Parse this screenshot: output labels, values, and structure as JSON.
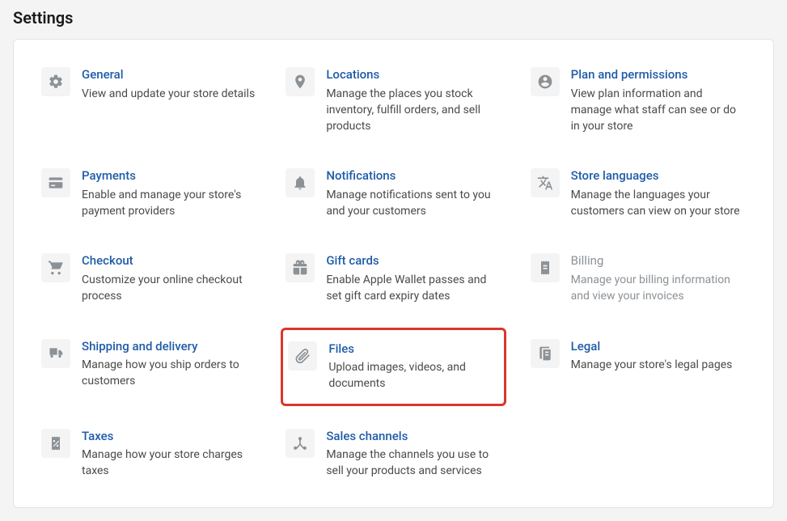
{
  "page_title": "Settings",
  "items": [
    {
      "title": "General",
      "desc": "View and update your store details"
    },
    {
      "title": "Locations",
      "desc": "Manage the places you stock inventory, fulfill orders, and sell products"
    },
    {
      "title": "Plan and permissions",
      "desc": "View plan information and manage what staff can see or do in your store"
    },
    {
      "title": "Payments",
      "desc": "Enable and manage your store's payment providers"
    },
    {
      "title": "Notifications",
      "desc": "Manage notifications sent to you and your customers"
    },
    {
      "title": "Store languages",
      "desc": "Manage the languages your customers can view on your store"
    },
    {
      "title": "Checkout",
      "desc": "Customize your online checkout process"
    },
    {
      "title": "Gift cards",
      "desc": "Enable Apple Wallet passes and set gift card expiry dates"
    },
    {
      "title": "Billing",
      "desc": "Manage your billing information and view your invoices"
    },
    {
      "title": "Shipping and delivery",
      "desc": "Manage how you ship orders to customers"
    },
    {
      "title": "Files",
      "desc": "Upload images, videos, and documents"
    },
    {
      "title": "Legal",
      "desc": "Manage your store's legal pages"
    },
    {
      "title": "Taxes",
      "desc": "Manage how your store charges taxes"
    },
    {
      "title": "Sales channels",
      "desc": "Manage the channels you use to sell your products and services"
    }
  ]
}
